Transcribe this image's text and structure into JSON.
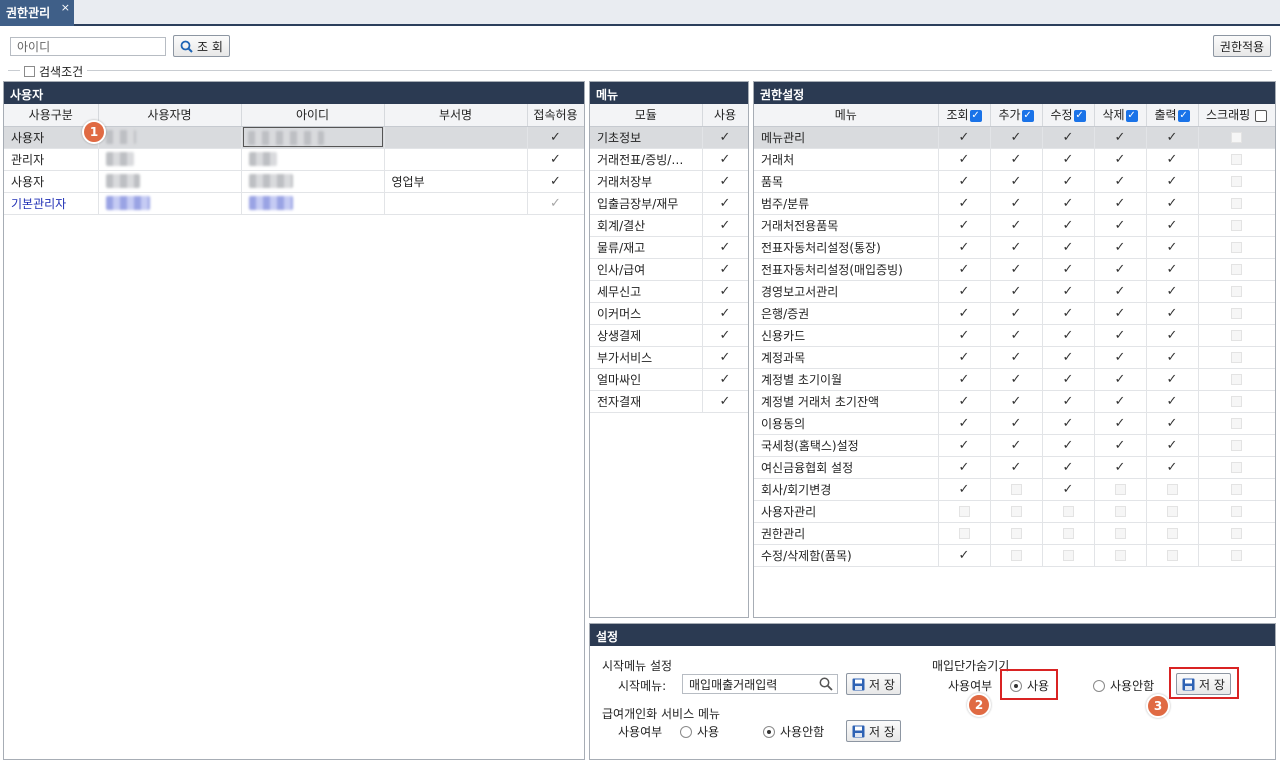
{
  "tab": {
    "title": "권한관리",
    "close": "×"
  },
  "toolbar": {
    "search_placeholder": "아이디",
    "search_label": "조 회",
    "apply_label": "권한적용",
    "filter_label": "검색조건"
  },
  "users": {
    "title": "사용자",
    "columns": [
      "사용구분",
      "사용자명",
      "아이디",
      "부서명",
      "접속허용"
    ],
    "rows": [
      {
        "type": "사용자",
        "dept": ""
      },
      {
        "type": "관리자",
        "dept": ""
      },
      {
        "type": "사용자",
        "dept": "영업부"
      },
      {
        "type": "기본관리자",
        "dept": ""
      }
    ]
  },
  "modules": {
    "title": "메뉴",
    "columns": [
      "모듈",
      "사용"
    ],
    "rows": [
      "기초정보",
      "거래전표/증빙/…",
      "거래처장부",
      "입출금장부/재무",
      "회계/결산",
      "물류/재고",
      "인사/급여",
      "세무신고",
      "이커머스",
      "상생결제",
      "부가서비스",
      "얼마싸인",
      "전자결재"
    ]
  },
  "perms": {
    "title": "권한설정",
    "columns": [
      "메뉴",
      "조회",
      "추가",
      "수정",
      "삭제",
      "출력",
      "스크래핑"
    ],
    "rows": [
      "메뉴관리",
      "거래처",
      "품목",
      "범주/분류",
      "거래처전용품목",
      "전표자동처리설정(통장)",
      "전표자동처리설정(매입증빙)",
      "경영보고서관리",
      "은행/증권",
      "신용카드",
      "계정과목",
      "계정별 초기이월",
      "계정별 거래처 초기잔액",
      "이용동의",
      "국세청(홈택스)설정",
      "여신금융협회 설정",
      "회사/회기변경",
      "사용자관리",
      "권한관리",
      "수정/삭제함(품목)"
    ]
  },
  "settings": {
    "title": "설정",
    "start_menu_section": "시작메뉴 설정",
    "start_menu_label": "시작메뉴:",
    "start_menu_value": "매입매출거래입력",
    "save_label": "저 장",
    "payroll_section": "급여개인화 서비스 메뉴",
    "payroll_use_label": "사용여부",
    "use_label": "사용",
    "not_use_label": "사용안함",
    "purchase_price_section": "매입단가숨기기",
    "purchase_use_label": "사용여부"
  },
  "markers": [
    "1",
    "2",
    "3"
  ]
}
